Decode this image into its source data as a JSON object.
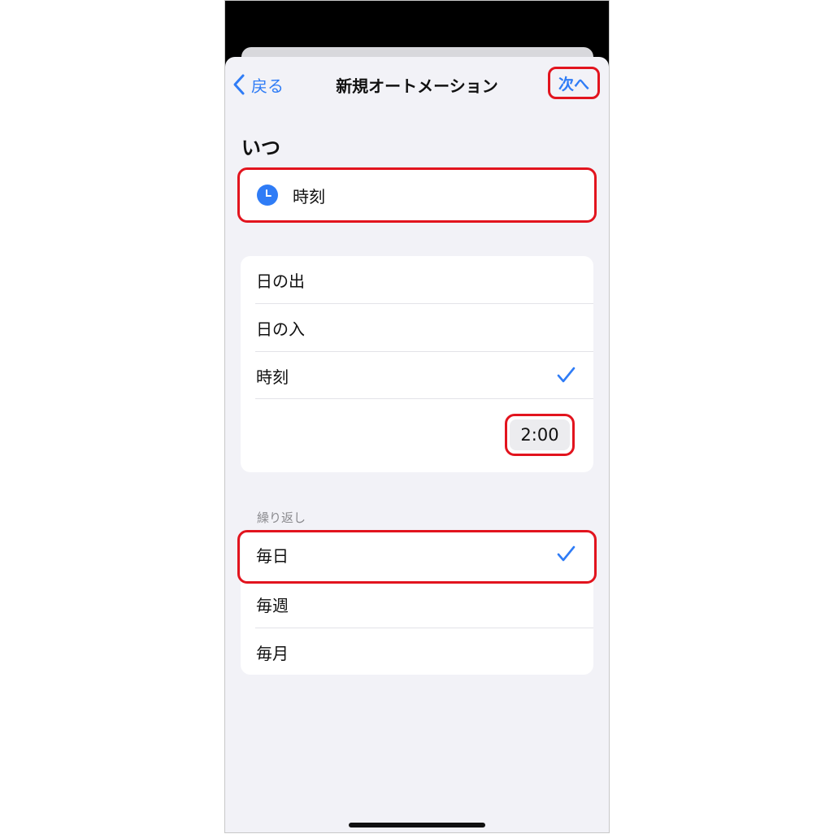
{
  "nav": {
    "back_label": "戻る",
    "title": "新規オートメーション",
    "next_label": "次へ"
  },
  "when": {
    "section_title": "いつ",
    "selected_trigger": "時刻"
  },
  "trigger_options": [
    {
      "label": "日の出",
      "selected": false
    },
    {
      "label": "日の入",
      "selected": false
    },
    {
      "label": "時刻",
      "selected": true
    }
  ],
  "time_value": "2:00",
  "repeat": {
    "section_label": "繰り返し",
    "options": [
      {
        "label": "毎日",
        "selected": true
      },
      {
        "label": "毎週",
        "selected": false
      },
      {
        "label": "毎月",
        "selected": false
      }
    ]
  },
  "colors": {
    "accent": "#2f7cf6",
    "highlight": "#e2141e",
    "background": "#f2f2f7"
  }
}
